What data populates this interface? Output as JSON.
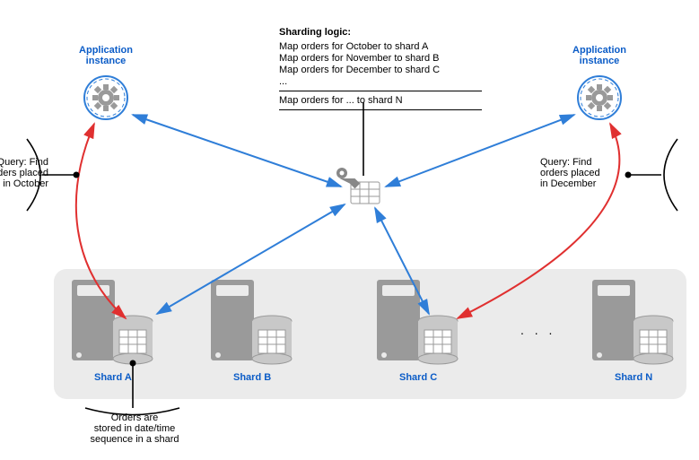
{
  "logic": {
    "title": "Sharding logic:",
    "rules": [
      "Map orders for October to shard A",
      "Map orders for November to shard B",
      "Map orders for December to shard C"
    ],
    "ellipsis": "...",
    "last": "Map orders for ... to shard N"
  },
  "app": {
    "left_label": "Application\ninstance",
    "right_label": "Application\ninstance"
  },
  "queries": {
    "left": "Query: Find\norders placed\nin October",
    "right": "Query: Find\norders placed\nin December"
  },
  "shards": {
    "a": "Shard A",
    "b": "Shard B",
    "c": "Shard C",
    "n": "Shard N",
    "dots": ". . ."
  },
  "footnote": "Orders are\nstored in date/time\nsequence in a shard"
}
